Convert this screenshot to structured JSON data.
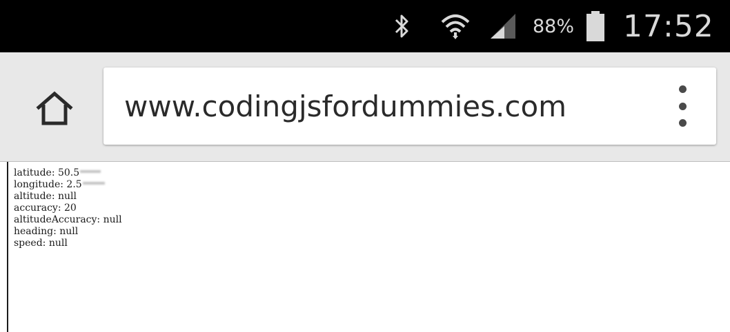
{
  "status_bar": {
    "icons": [
      "bluetooth-icon",
      "wifi-icon",
      "cell-signal-icon",
      "battery-icon"
    ],
    "battery_percent": "88%",
    "time": "17:52"
  },
  "toolbar": {
    "home_icon": "home-icon",
    "url": "www.codingjsfordummies.com",
    "menu_icon": "overflow-menu-icon"
  },
  "geolocation": {
    "latitude_label": "latitude: 50.5",
    "longitude_label": "longitude: 2.5",
    "altitude_label": "altitude: null",
    "accuracy_label": "accuracy: 20",
    "altitude_accuracy_label": "altitudeAccuracy: null",
    "heading_label": "heading: null",
    "speed_label": "speed: null"
  },
  "colors": {
    "status_bar_bg": "#000000",
    "toolbar_bg": "#e8e8e8",
    "url_box_bg": "#ffffff",
    "text": "#1a1a1a"
  }
}
